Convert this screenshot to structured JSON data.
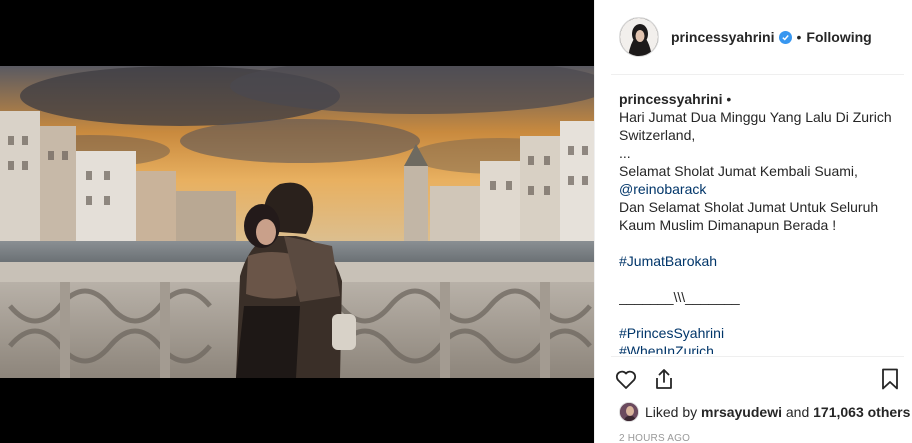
{
  "post": {
    "username": "princessyahrini",
    "separator": "•",
    "follow_status": "Following",
    "verified_icon": "verified-badge-icon",
    "accent_color": "#3897f0",
    "link_color": "#003569"
  },
  "caption": {
    "username": "princessyahrini",
    "after_username": " •",
    "lines": [
      "Hari Jumat Dua Minggu Yang Lalu Di Zurich",
      "Switzerland,",
      "...",
      "Selamat Sholat Jumat Kembali Suami,"
    ],
    "mention": "@reinobarack",
    "lines2": [
      "Dan Selamat Sholat Jumat Untuk Seluruh",
      "Kaum Muslim Dimanapun Berada !"
    ],
    "hashtag1": "#JumatBarokah",
    "divider_text": "_______\\\\\\_______",
    "hashtag2": "#PrincesSyahrini",
    "hashtag3": "#WhenInZurich"
  },
  "actions": {
    "like_icon": "heart-icon",
    "share_icon": "share-icon",
    "save_icon": "bookmark-icon"
  },
  "likes": {
    "prefix": "Liked by ",
    "user": "mrsayudewi",
    "middle": " and ",
    "count": "171,063 others"
  },
  "timestamp": "2 HOURS AGO"
}
